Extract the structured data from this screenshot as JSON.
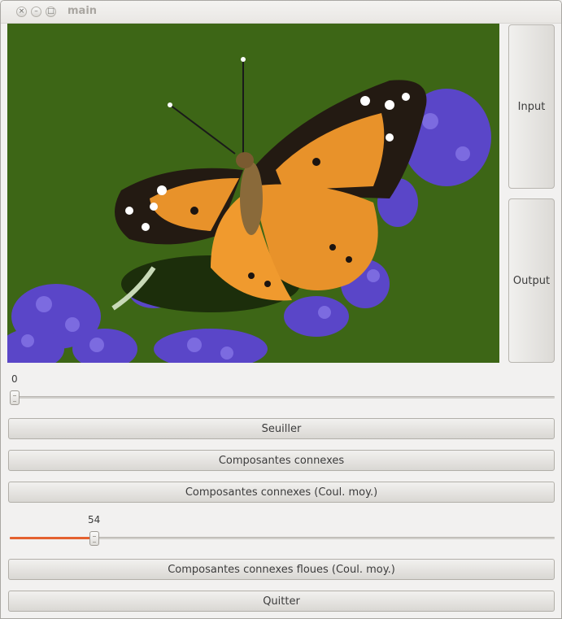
{
  "window": {
    "title": "main"
  },
  "titlebar_icons": {
    "close": "×",
    "minimize": "–",
    "maximize": "□"
  },
  "image": {
    "description_icon": "butterfly-image"
  },
  "side_buttons": {
    "input": "Input",
    "output": "Output"
  },
  "slider1": {
    "value": "0",
    "fraction": 0.0
  },
  "slider2": {
    "value": "54",
    "fraction": 0.155,
    "accent": "#e4612f"
  },
  "buttons": {
    "seuiller": "Seuiller",
    "composantes": "Composantes connexes",
    "composantes_moy": "Composantes connexes (Coul. moy.)",
    "composantes_floues": "Composantes connexes floues (Coul. moy.)",
    "quitter": "Quitter"
  }
}
